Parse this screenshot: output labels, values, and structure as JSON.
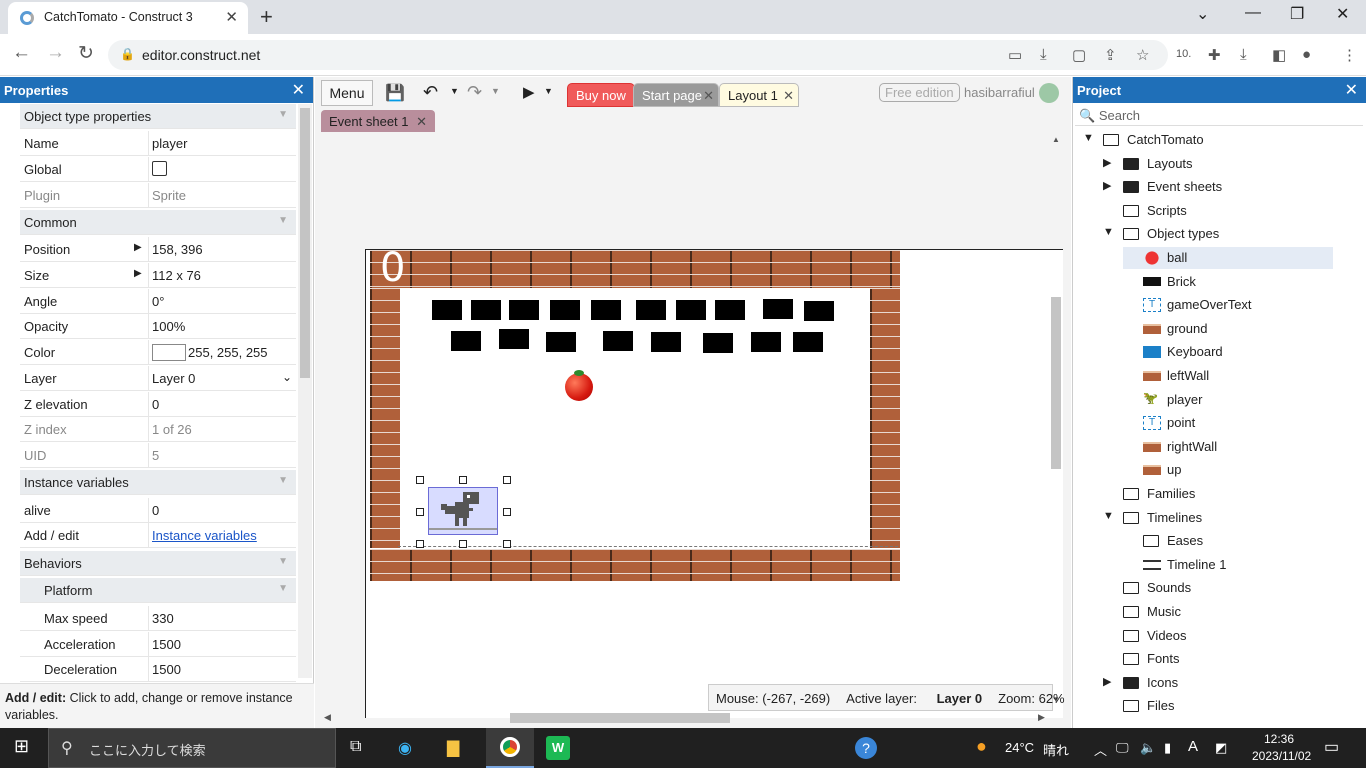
{
  "browser": {
    "tab_title": "CatchTomato - Construct 3",
    "url": "editor.construct.net"
  },
  "properties_panel": {
    "title": "Properties",
    "rows": [
      {
        "key": "Object type properties",
        "type": "cat"
      },
      {
        "key": "Name",
        "value": "player"
      },
      {
        "key": "Global",
        "value": ""
      },
      {
        "key": "Plugin",
        "value": "Sprite",
        "grey": true
      },
      {
        "key": "Common",
        "type": "cat"
      },
      {
        "key": "Position",
        "value": "158, 396",
        "arrow": true
      },
      {
        "key": "Size",
        "value": "112 x 76",
        "arrow": true
      },
      {
        "key": "Angle",
        "value": "0°"
      },
      {
        "key": "Opacity",
        "value": "100%"
      },
      {
        "key": "Color",
        "value": "255, 255, 255"
      },
      {
        "key": "Layer",
        "value": "Layer 0"
      },
      {
        "key": "Z elevation",
        "value": "0"
      },
      {
        "key": "Z index",
        "value": "1 of 26",
        "grey": true
      },
      {
        "key": "UID",
        "value": "5",
        "grey": true
      },
      {
        "key": "Instance variables",
        "type": "cat"
      },
      {
        "key": "alive",
        "value": "0"
      },
      {
        "key": "Add / edit",
        "value": "Instance variables",
        "link": true
      },
      {
        "key": "Behaviors",
        "type": "cat"
      },
      {
        "key": "Platform",
        "type": "subcat"
      },
      {
        "key": "Max speed",
        "value": "330",
        "sub": true
      },
      {
        "key": "Acceleration",
        "value": "1500",
        "sub": true
      },
      {
        "key": "Deceleration",
        "value": "1500",
        "sub": true
      }
    ],
    "help_bold": "Add / edit:",
    "help_text": " Click to add, change or remove instance variables."
  },
  "editor": {
    "menu_label": "Menu",
    "tabs": [
      "Buy now",
      "Start page",
      "Layout 1"
    ],
    "event_sheet_tab": "Event sheet 1",
    "free_edition": "Free edition",
    "username": "hasibarrafiul",
    "score": "0",
    "status": {
      "mouse": "Mouse: (-267, -269)",
      "layer_label": "Active layer: ",
      "layer_value": "Layer 0",
      "zoom": "Zoom: 62%"
    }
  },
  "project_panel": {
    "title": "Project",
    "search_placeholder": "Search",
    "tree": [
      {
        "label": "CatchTomato",
        "level": 0,
        "exp": "down",
        "icon": "folder"
      },
      {
        "label": "Layouts",
        "level": 1,
        "exp": "right",
        "icon": "folder-filled"
      },
      {
        "label": "Event sheets",
        "level": 1,
        "exp": "right",
        "icon": "folder-filled"
      },
      {
        "label": "Scripts",
        "level": 1,
        "exp": "",
        "icon": "folder"
      },
      {
        "label": "Object types",
        "level": 1,
        "exp": "down",
        "icon": "folder"
      },
      {
        "label": "ball",
        "level": 2,
        "exp": "",
        "icon": "tomato",
        "selected": true
      },
      {
        "label": "Brick",
        "level": 2,
        "exp": "",
        "icon": "black-rect"
      },
      {
        "label": "gameOverText",
        "level": 2,
        "exp": "",
        "icon": "text"
      },
      {
        "label": "ground",
        "level": 2,
        "exp": "",
        "icon": "brick"
      },
      {
        "label": "Keyboard",
        "level": 2,
        "exp": "",
        "icon": "keyboard"
      },
      {
        "label": "leftWall",
        "level": 2,
        "exp": "",
        "icon": "brick"
      },
      {
        "label": "player",
        "level": 2,
        "exp": "",
        "icon": "dino"
      },
      {
        "label": "point",
        "level": 2,
        "exp": "",
        "icon": "text"
      },
      {
        "label": "rightWall",
        "level": 2,
        "exp": "",
        "icon": "brick"
      },
      {
        "label": "up",
        "level": 2,
        "exp": "",
        "icon": "brick"
      },
      {
        "label": "Families",
        "level": 1,
        "exp": "",
        "icon": "folder"
      },
      {
        "label": "Timelines",
        "level": 1,
        "exp": "down",
        "icon": "folder"
      },
      {
        "label": "Eases",
        "level": 2,
        "exp": "",
        "icon": "folder"
      },
      {
        "label": "Timeline 1",
        "level": 2,
        "exp": "",
        "icon": "timeline"
      },
      {
        "label": "Sounds",
        "level": 1,
        "exp": "",
        "icon": "folder"
      },
      {
        "label": "Music",
        "level": 1,
        "exp": "",
        "icon": "folder"
      },
      {
        "label": "Videos",
        "level": 1,
        "exp": "",
        "icon": "folder"
      },
      {
        "label": "Fonts",
        "level": 1,
        "exp": "",
        "icon": "folder"
      },
      {
        "label": "Icons",
        "level": 1,
        "exp": "right",
        "icon": "folder-filled"
      },
      {
        "label": "Files",
        "level": 1,
        "exp": "",
        "icon": "folder"
      }
    ]
  },
  "taskbar": {
    "search_placeholder": "ここに入力して検索",
    "weather_temp": "24°C",
    "weather_text": "晴れ",
    "ime": "A",
    "time": "12:36",
    "date": "2023/11/02"
  }
}
